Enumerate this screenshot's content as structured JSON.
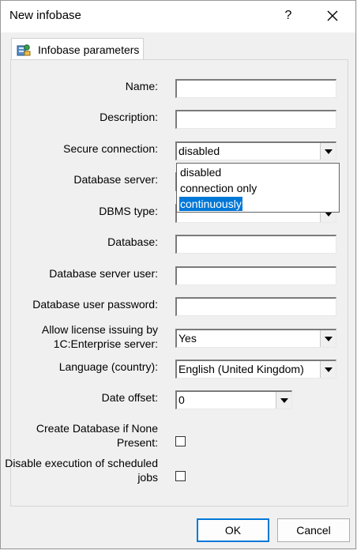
{
  "window": {
    "title": "New infobase",
    "help_label": "?"
  },
  "tab": {
    "label": "Infobase parameters"
  },
  "fields": {
    "name_label": "Name:",
    "name_value": "",
    "description_label": "Description:",
    "description_value": "",
    "secure_label": "Secure connection:",
    "secure_value": "disabled",
    "server_label": "Database server:",
    "dbms_label": "DBMS type:",
    "database_label": "Database:",
    "db_user_label": "Database server user:",
    "db_password_label": "Database user password:",
    "license_label_1": "Allow license issuing by",
    "license_label_2": "1C:Enterprise server:",
    "license_value": "Yes",
    "language_label": "Language (country):",
    "language_value": "English (United Kingdom)",
    "date_offset_label": "Date offset:",
    "date_offset_value": "0",
    "create_db_label_1": "Create Database if None",
    "create_db_label_2": "Present:",
    "disable_jobs_label_1": "Disable execution of scheduled",
    "disable_jobs_label_2": "jobs"
  },
  "dropdown": {
    "options": [
      "disabled",
      "connection only",
      "continuously"
    ],
    "selected_index": 2
  },
  "buttons": {
    "ok": "OK",
    "cancel": "Cancel"
  },
  "colors": {
    "selection": "#0078d7",
    "accent_border": "#0078d7"
  }
}
